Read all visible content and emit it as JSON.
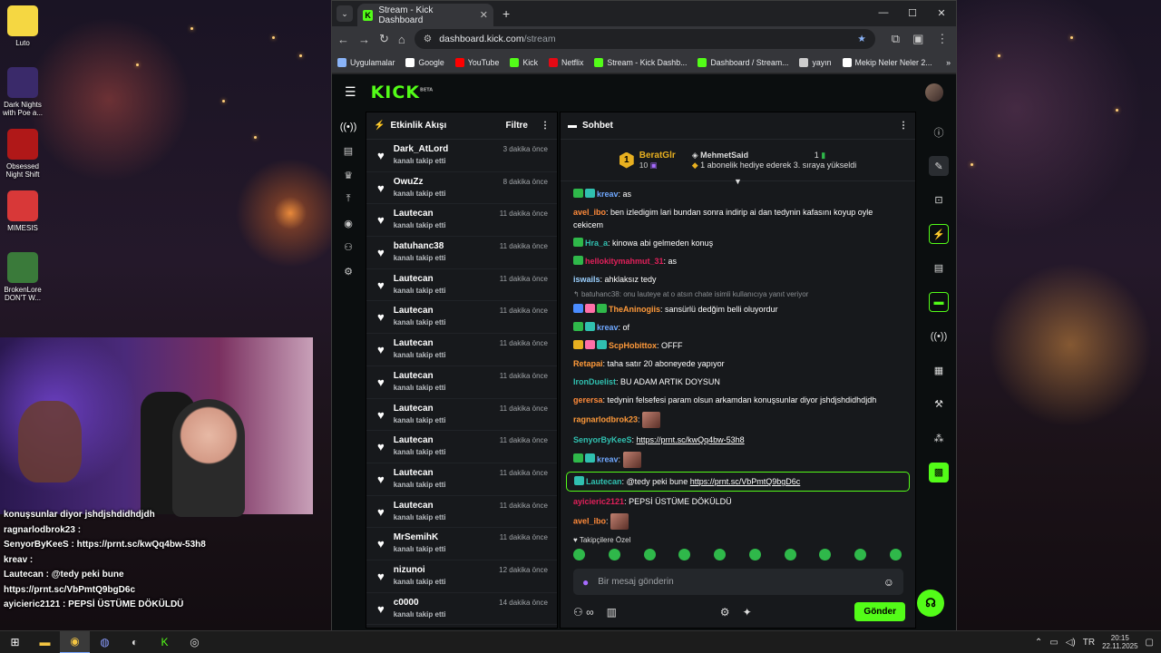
{
  "desktop": {
    "icons": [
      {
        "label": "Luto",
        "icon": "smiley-folder-icon",
        "color": "#f5d742"
      },
      {
        "label": "Dark Nights with Poe a...",
        "icon": "game-icon",
        "color": "#3a2a6a"
      },
      {
        "label": "Obsessed Night Shift",
        "icon": "game-icon",
        "color": "#b01818"
      },
      {
        "label": "MIMESIS",
        "icon": "game-icon",
        "color": "#d83838"
      },
      {
        "label": "BrokenLore DON'T W...",
        "icon": "game-icon",
        "color": "#3a7a3a"
      }
    ]
  },
  "overlay_chat": [
    "konuşsunlar diyor jshdjshdidhdjdh",
    "ragnarlodbrok23 :",
    "SenyorByKeeS : https://prnt.sc/kwQq4bw-53h8",
    "kreav :",
    "Lautecan : @tedy peki bune",
    "https://prnt.sc/VbPmtQ9bgD6c",
    "ayicieric2121 : PEPSİ ÜSTÜME DÖKÜLDÜ"
  ],
  "browser": {
    "tab_title": "Stream - Kick Dashboard",
    "url_host": "dashboard.kick.com",
    "url_path": "/stream",
    "bookmarks": [
      {
        "label": "Uygulamalar",
        "color": "#8ab4f8"
      },
      {
        "label": "Google",
        "color": "#ffffff"
      },
      {
        "label": "YouTube",
        "color": "#ff0000"
      },
      {
        "label": "Kick",
        "color": "#53fc18"
      },
      {
        "label": "Netflix",
        "color": "#e50914"
      },
      {
        "label": "Stream - Kick Dashb...",
        "color": "#53fc18"
      },
      {
        "label": "Dashboard / Stream...",
        "color": "#53fc18"
      },
      {
        "label": "yayın",
        "color": "#cccccc"
      },
      {
        "label": "Mekip Neler Neler 2...",
        "color": "#ffffff"
      }
    ],
    "bookmarks_more": "»"
  },
  "kick": {
    "logo": "KICK",
    "logo_beta": "BETA",
    "activity": {
      "title": "Etkinlik Akışı",
      "filter": "Filtre",
      "items": [
        {
          "name": "Dark_AtLord",
          "action": "kanalı takip etti",
          "time": "3 dakika önce"
        },
        {
          "name": "OwuZz",
          "action": "kanalı takip etti",
          "time": "8 dakika önce"
        },
        {
          "name": "Lautecan",
          "action": "kanalı takip etti",
          "time": "11 dakika önce"
        },
        {
          "name": "batuhanc38",
          "action": "kanalı takip etti",
          "time": "11 dakika önce"
        },
        {
          "name": "Lautecan",
          "action": "kanalı takip etti",
          "time": "11 dakika önce"
        },
        {
          "name": "Lautecan",
          "action": "kanalı takip etti",
          "time": "11 dakika önce"
        },
        {
          "name": "Lautecan",
          "action": "kanalı takip etti",
          "time": "11 dakika önce"
        },
        {
          "name": "Lautecan",
          "action": "kanalı takip etti",
          "time": "11 dakika önce"
        },
        {
          "name": "Lautecan",
          "action": "kanalı takip etti",
          "time": "11 dakika önce"
        },
        {
          "name": "Lautecan",
          "action": "kanalı takip etti",
          "time": "11 dakika önce"
        },
        {
          "name": "Lautecan",
          "action": "kanalı takip etti",
          "time": "11 dakika önce"
        },
        {
          "name": "Lautecan",
          "action": "kanalı takip etti",
          "time": "11 dakika önce"
        },
        {
          "name": "MrSemihK",
          "action": "kanalı takip etti",
          "time": "11 dakika önce"
        },
        {
          "name": "nizunoi",
          "action": "kanalı takip etti",
          "time": "12 dakika önce"
        },
        {
          "name": "c0000",
          "action": "kanalı takip etti",
          "time": "14 dakika önce"
        }
      ]
    },
    "chat": {
      "title": "Sohbet",
      "pinned": {
        "rank": "1",
        "top_name": "BeratGlr",
        "top_count": "10",
        "gifter": "MehmetSaid",
        "gifter_count": "1",
        "gifter_info": "1 abonelik hediye ederek 3. sıraya yükseldi"
      },
      "messages": [
        {
          "name": "kreav",
          "color": "#6fa8ff",
          "text": ": as",
          "badges": [
            "green",
            "teal"
          ]
        },
        {
          "name": "avel_ibo",
          "color": "#ff8a3a",
          "text": ": ben izledigim  lari bundan sonra indirip ai dan tedynin kafasını koyup oyle cekicem",
          "badges": []
        },
        {
          "name": "Hra_a",
          "color": "#30c0b0",
          "text": ": kinowa abi gelmeden konuş",
          "badges": [
            "green"
          ]
        },
        {
          "name": "hellokitymahmut_31",
          "color": "#e0205a",
          "text": ": as",
          "badges": [
            "green"
          ]
        },
        {
          "name": "iswails",
          "color": "#9ad0ff",
          "text": ": ahklaksız tedy",
          "badges": []
        },
        {
          "reply": "batuhanc38: onu lauteye at o atsın chate isimli kullanıcıya yanıt veriyor"
        },
        {
          "name": "TheAninogiis",
          "color": "#ff9a3a",
          "text": ": sansürlü dedğim belli oluyordur",
          "badges": [
            "blue",
            "pink",
            "green"
          ]
        },
        {
          "name": "kreav",
          "color": "#6fa8ff",
          "text": ": of",
          "badges": [
            "green",
            "teal"
          ]
        },
        {
          "name": "ScpHobittox",
          "color": "#ff9a3a",
          "text": ": OFFF",
          "badges": [
            "gold",
            "pink",
            "teal"
          ]
        },
        {
          "name": "Retapai",
          "color": "#ff9a3a",
          "text": ": taha satır 20 aboneyede yapıyor",
          "badges": []
        },
        {
          "name": "IronDuelist",
          "color": "#30c0b0",
          "text": ": BU ADAM ARTIK DOYSUN",
          "badges": []
        },
        {
          "name": "gerersa",
          "color": "#ff8a3a",
          "text": ": tedynin felsefesi param olsun arkamdan konuşsunlar diyor jshdjshdidhdjdh",
          "badges": []
        },
        {
          "name": "ragnarlodbrok23",
          "color": "#ff9a3a",
          "text": ":",
          "badges": [],
          "emote": true
        },
        {
          "name": "SenyorByKeeS",
          "color": "#30c0b0",
          "text": ": ",
          "link": "https://prnt.sc/kwQq4bw-53h8",
          "badges": []
        },
        {
          "name": "kreav",
          "color": "#6fa8ff",
          "text": ":",
          "badges": [
            "green",
            "teal"
          ],
          "emote": true
        },
        {
          "name": "Lautecan",
          "color": "#30c0b0",
          "text": ": @tedy peki bune ",
          "link": "https://prnt.sc/VbPmtQ9bgD6c",
          "badges": [
            "teal"
          ],
          "highlight": true
        },
        {
          "name": "ayicieric2121",
          "color": "#e0205a",
          "text": ": PEPSİ ÜSTÜME DÖKÜLDÜ",
          "badges": []
        },
        {
          "name": "avel_ibo",
          "color": "#ff8a3a",
          "text": ":",
          "badges": [],
          "emote": true
        }
      ],
      "followers_only": "Takipçilere Özel",
      "input_placeholder": "Bir mesaj gönderin",
      "send": "Gönder"
    }
  },
  "taskbar": {
    "time": "20:15",
    "date": "22.11.2025"
  }
}
